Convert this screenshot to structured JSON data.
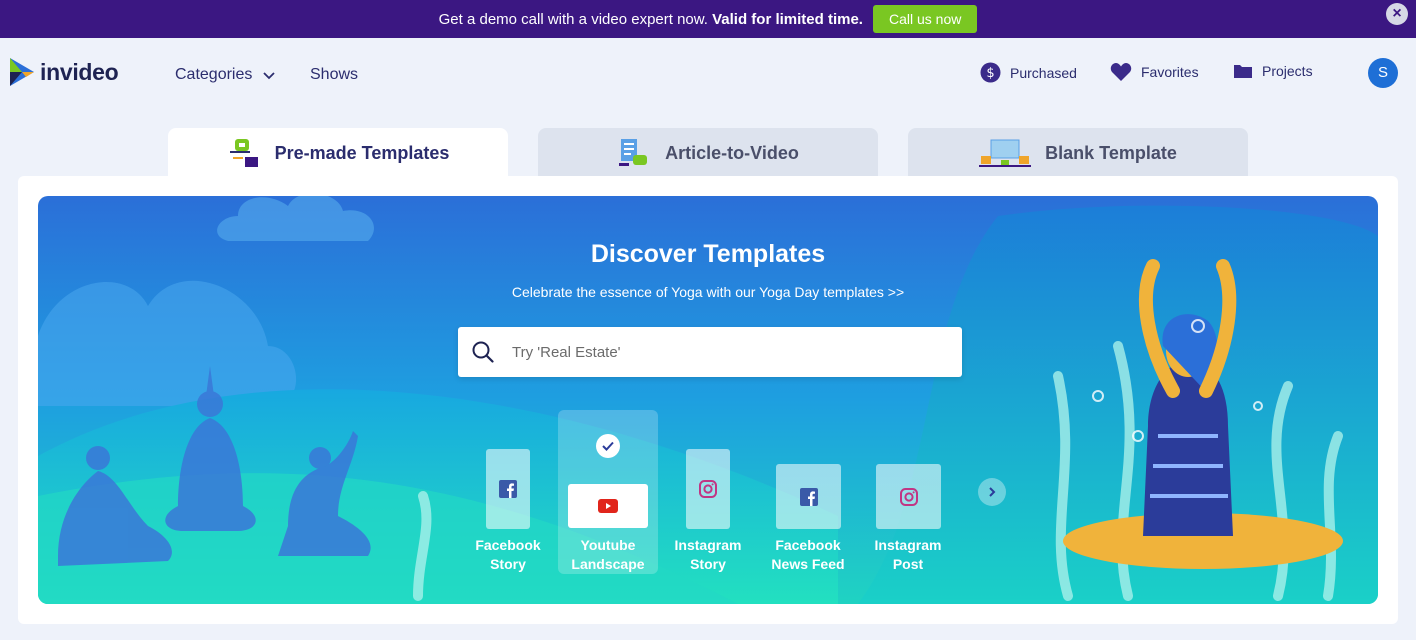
{
  "promo": {
    "text": "Get a demo call with a video expert now.",
    "highlight": "Valid for limited time.",
    "cta": "Call us now",
    "close_glyph": "×"
  },
  "header": {
    "logo_text": "invideo",
    "nav": [
      {
        "label": "Categories",
        "icon": "chevron-down-icon"
      },
      {
        "label": "Shows"
      }
    ],
    "right": [
      {
        "label": "Purchased",
        "icon": "dollar-coin-icon"
      },
      {
        "label": "Favorites",
        "icon": "heart-icon"
      },
      {
        "label": "Projects",
        "icon": "folder-icon"
      }
    ],
    "avatar_initial": "S"
  },
  "tabs": [
    {
      "label": "Pre-made Templates",
      "active": true
    },
    {
      "label": "Article-to-Video",
      "active": false
    },
    {
      "label": "Blank Template",
      "active": false
    }
  ],
  "hero": {
    "title": "Discover Templates",
    "subtitle": "Celebrate the essence of Yoga with our Yoga Day templates >>",
    "search_placeholder": "Try 'Real Estate'",
    "formats": [
      {
        "line1": "Facebook",
        "line2": "Story",
        "icon": "facebook-icon",
        "selected": false
      },
      {
        "line1": "Youtube",
        "line2": "Landscape",
        "icon": "youtube-icon",
        "selected": true
      },
      {
        "line1": "Instagram",
        "line2": "Story",
        "icon": "instagram-icon",
        "selected": false
      },
      {
        "line1": "Facebook",
        "line2": "News Feed",
        "icon": "facebook-icon",
        "selected": false
      },
      {
        "line1": "Instagram",
        "line2": "Post",
        "icon": "instagram-icon",
        "selected": false
      }
    ]
  },
  "colors": {
    "promo_bg": "#3b1782",
    "cta_green": "#7ac722",
    "brand_navy": "#2b2d6e",
    "avatar_blue": "#1e6fd6",
    "hero_blue": "#2b6fd8",
    "hero_teal": "#1fd3c2"
  }
}
